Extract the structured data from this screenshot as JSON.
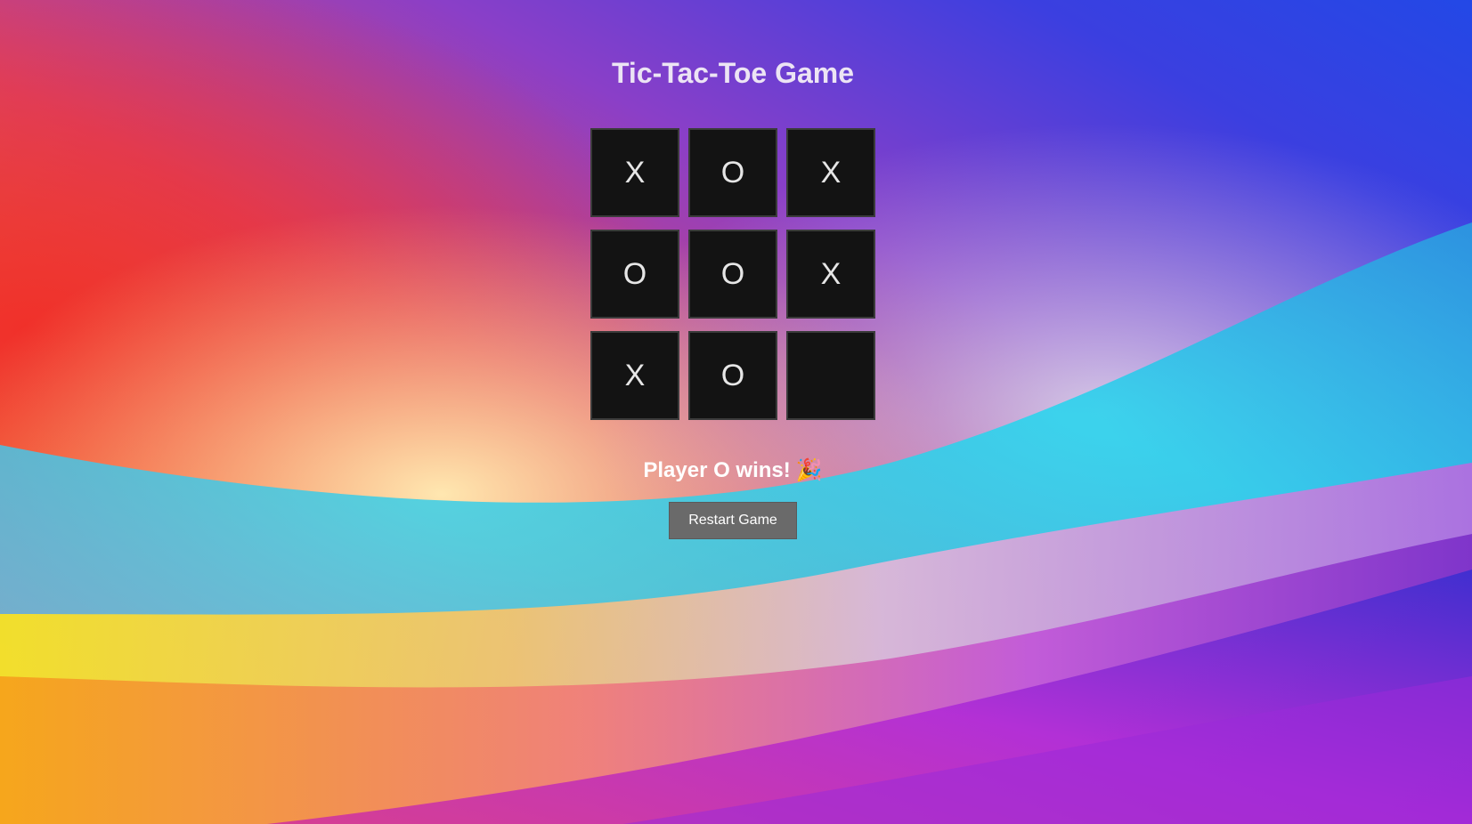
{
  "page": {
    "title": "Tic-Tac-Toe Game"
  },
  "board": {
    "cells": [
      "X",
      "O",
      "X",
      "O",
      "O",
      "X",
      "X",
      "O",
      ""
    ]
  },
  "status": {
    "text": "Player O wins!",
    "emoji": "🎉"
  },
  "controls": {
    "restart_label": "Restart Game"
  },
  "colors": {
    "cell_background": "#131313",
    "cell_border": "#3b3b3b",
    "mark_color": "#e6e6e6",
    "button_background": "#6a6a6a",
    "title_color": "#ece4f4"
  }
}
